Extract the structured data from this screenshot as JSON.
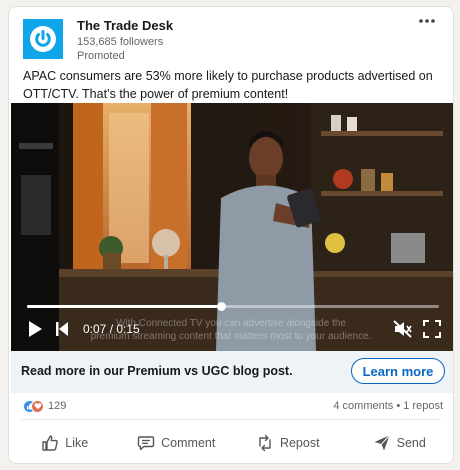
{
  "post": {
    "company": "The Trade Desk",
    "followers": "153,685 followers",
    "promoted": "Promoted",
    "more_icon": "more-horizontal-icon",
    "text": "APAC consumers are 53% more likely to purchase products advertised on OTT/CTV. That’s the power of premium content!"
  },
  "video": {
    "time_label": "0:07 / 0:15",
    "progress": 0.47,
    "caption_line1": "With Connected TV you can advertise alongside the",
    "caption_line2": "premium streaming content that matters most to your audience.",
    "icons": [
      "play-icon",
      "skip-back-icon",
      "mute-icon",
      "fullscreen-icon"
    ]
  },
  "cta": {
    "text": "Read more in our Premium vs UGC blog post.",
    "button": "Learn more"
  },
  "social": {
    "reaction_count": "129",
    "stats": "4 comments • 1 repost"
  },
  "actions": {
    "like": "Like",
    "comment": "Comment",
    "repost": "Repost",
    "send": "Send"
  },
  "colors": {
    "brand_blue": "#0a66c2",
    "logo_bg": "#0ea5e9",
    "cta_bg": "#eef3f8"
  }
}
